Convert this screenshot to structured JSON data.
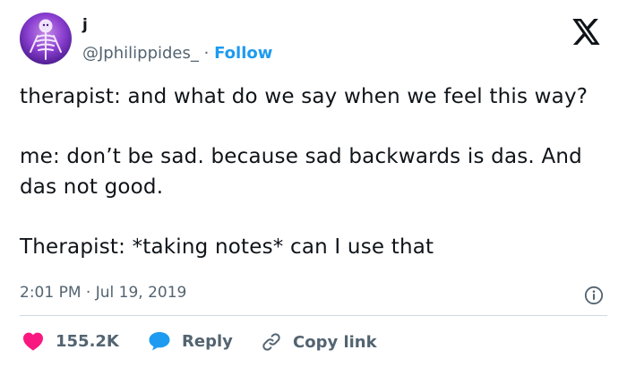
{
  "author": {
    "name": "j",
    "handle": "@Jphilippides_",
    "separator": "·",
    "follow_label": "Follow"
  },
  "tweet": {
    "paragraphs": [
      "therapist: and what do we say when we feel this way?",
      "me: don’t be sad. because sad backwards is das. And das not good.",
      "Therapist: *taking notes* can I use that"
    ],
    "timestamp": "2:01 PM · Jul 19, 2019"
  },
  "actions": {
    "like_count": "155.2K",
    "reply_label": "Reply",
    "copy_label": "Copy link"
  },
  "colors": {
    "accent": "#1d9bf0",
    "like": "#f91880",
    "text": "#0f1419",
    "muted": "#536471"
  },
  "icons": [
    "x-logo-icon",
    "info-icon",
    "heart-icon",
    "reply-bubble-icon",
    "link-icon"
  ]
}
